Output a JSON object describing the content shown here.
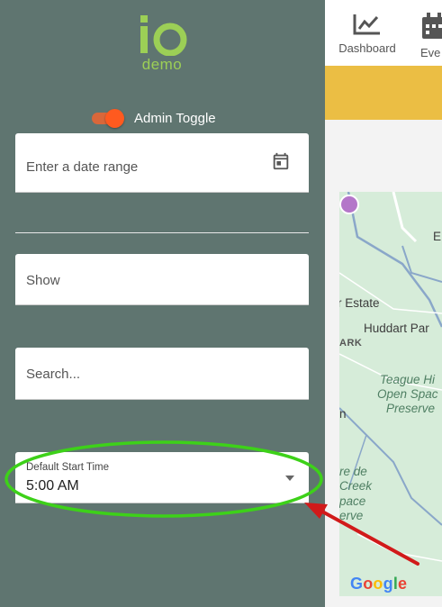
{
  "brand": {
    "logo_text": "io",
    "subtitle": "demo"
  },
  "admin_toggle": {
    "label": "Admin Toggle",
    "state": "on",
    "color": "#ff5a1f"
  },
  "filters": {
    "date_range": {
      "placeholder": "Enter a date range",
      "icon": "calendar-icon"
    },
    "show": {
      "placeholder": "Show"
    },
    "search": {
      "placeholder": "Search..."
    },
    "default_start_time": {
      "label": "Default Start Time",
      "value": "5:00 AM",
      "icon": "chevron-down-icon"
    }
  },
  "nav": {
    "items": [
      {
        "label": "Dashboard",
        "icon": "chart-line-icon"
      },
      {
        "label": "Eve",
        "icon": "calendar-icon"
      }
    ]
  },
  "map": {
    "labels": [
      "E",
      "r Estate",
      "Huddart Par",
      "ARK",
      "Teague Hi",
      "Open Spac",
      "Preserve",
      "n",
      "re de",
      "Creek",
      "pace",
      "erve"
    ],
    "attribution": "Google"
  },
  "colors": {
    "sidebar": "#5f7570",
    "banner": "#ebbe44",
    "logo": "#9ccf56",
    "highlight": "#3dd119",
    "arrow": "#d11a1a"
  }
}
